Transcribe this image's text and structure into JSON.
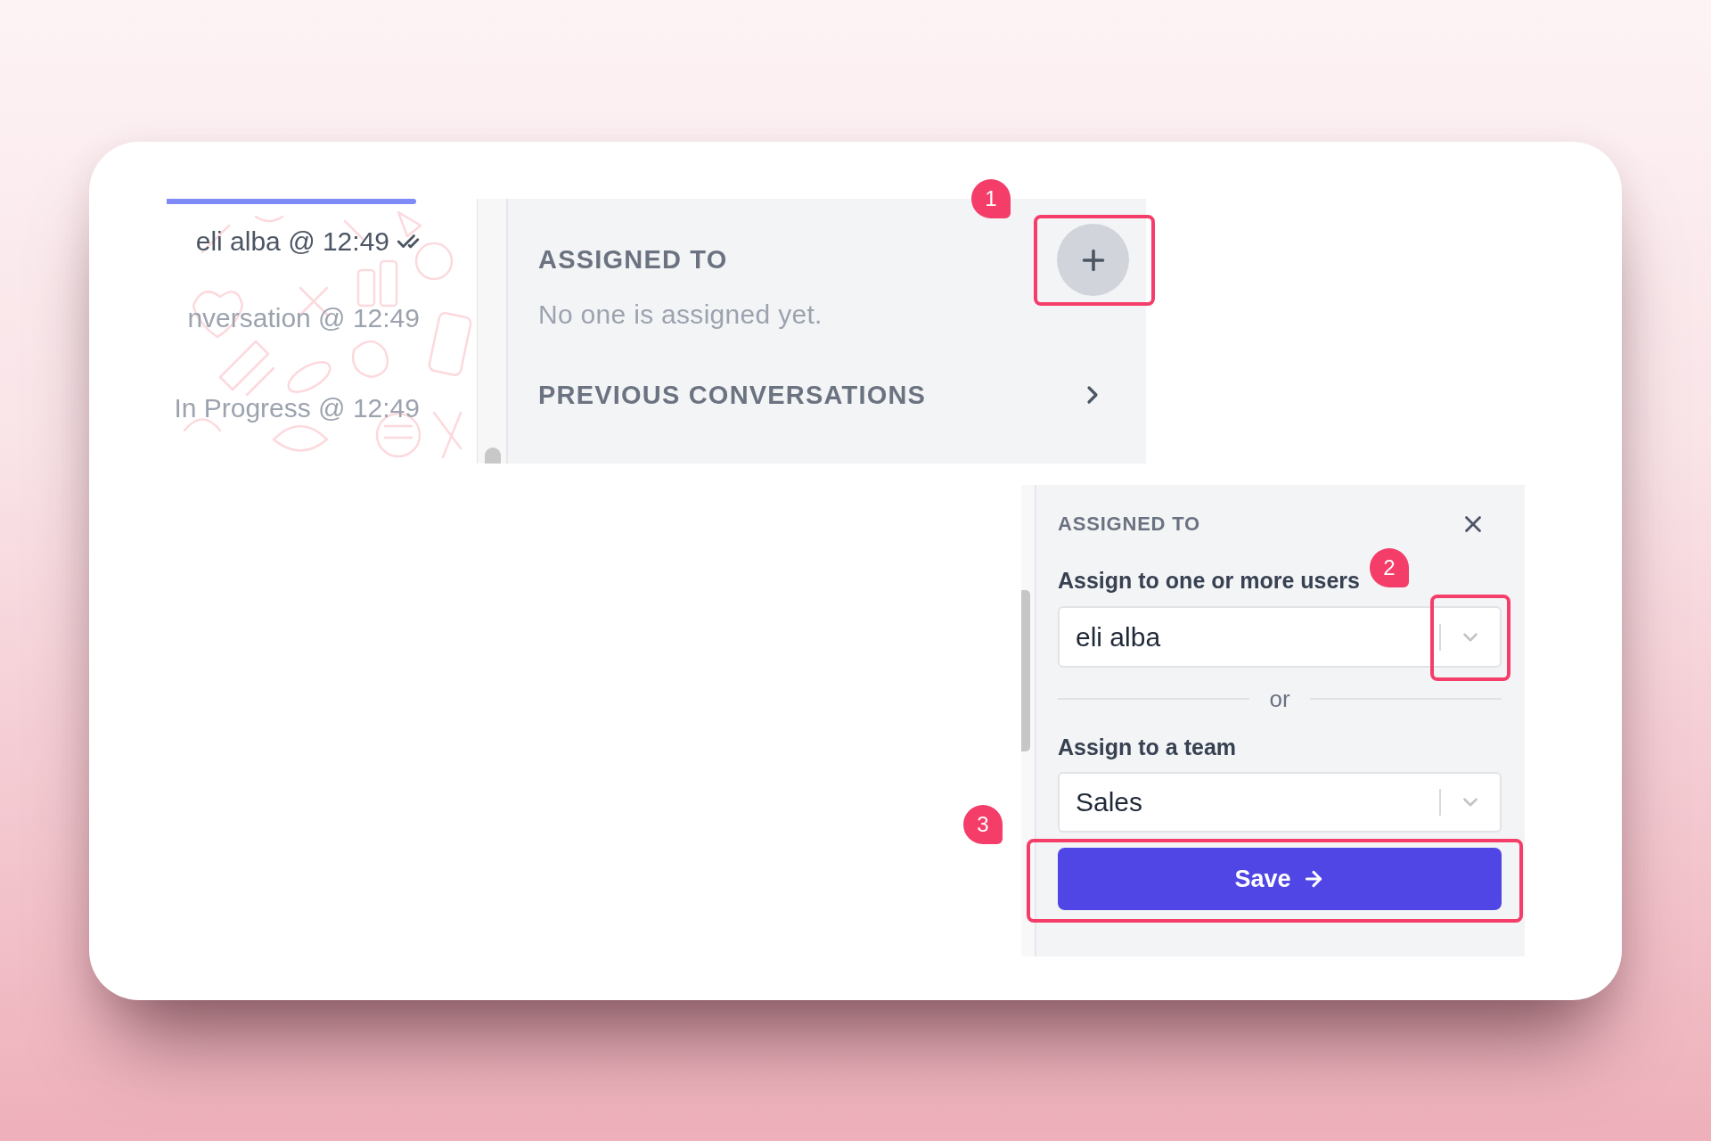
{
  "chat_preview": {
    "messages": [
      {
        "kind": "message",
        "text": "eli alba @ 12:49"
      },
      {
        "kind": "activity",
        "text": "nversation @ 12:49"
      },
      {
        "kind": "activity",
        "text": "In Progress @ 12:49"
      }
    ]
  },
  "assigned_panel": {
    "title": "ASSIGNED TO",
    "empty_text": "No one is assigned yet.",
    "previous_conversations": "PREVIOUS CONVERSATIONS"
  },
  "assign_dialog": {
    "title": "ASSIGNED TO",
    "users_label": "Assign to one or more users",
    "users_select": {
      "value": "eli alba"
    },
    "divider_text": "or",
    "team_label": "Assign to a team",
    "team_select": {
      "value": "Sales"
    },
    "save_button": "Save"
  },
  "annotations": [
    {
      "label": "1"
    },
    {
      "label": "2"
    },
    {
      "label": "3"
    }
  ]
}
